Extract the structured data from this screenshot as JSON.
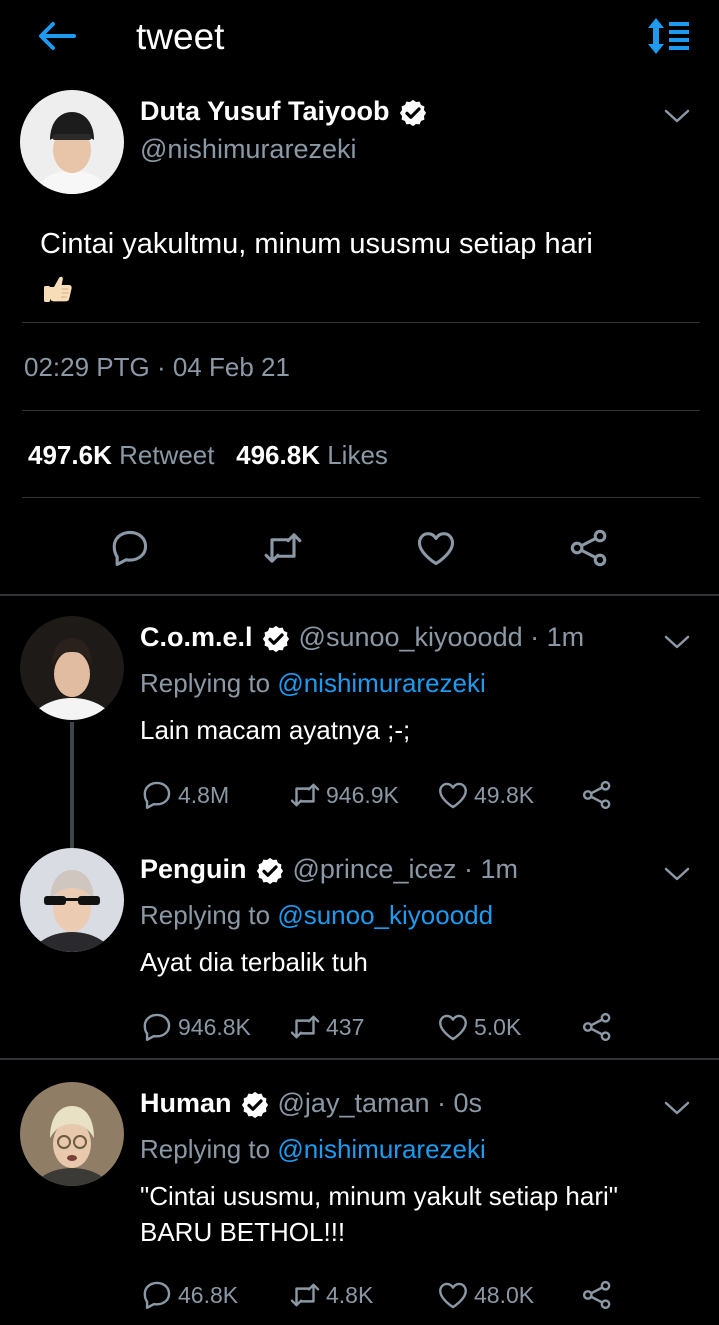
{
  "header": {
    "title": "tweet"
  },
  "tweet": {
    "name": "Duta Yusuf Taiyoob",
    "handle": "@nishimurarezeki",
    "text": "Cintai yakultmu, minum ususmu setiap hari",
    "timestamp": "02:29 PTG · 04 Feb 21",
    "retweet_count": "497.6K",
    "retweet_label": "Retweet",
    "like_count": "496.8K",
    "like_label": "Likes"
  },
  "replies": [
    {
      "name": "C.o.m.e.l",
      "handle": "@sunoo_kiyooodd",
      "time": "· 1m",
      "replying_label": "Replying to",
      "replying_to": "@nishimurarezeki",
      "text": "Lain macam ayatnya ;-;",
      "reply_count": "4.8M",
      "retweet_count": "946.9K",
      "like_count": "49.8K"
    },
    {
      "name": "Penguin",
      "handle": "@prince_icez",
      "time": "· 1m",
      "replying_label": "Replying to",
      "replying_to": "@sunoo_kiyooodd",
      "text": "Ayat dia terbalik tuh",
      "reply_count": "946.8K",
      "retweet_count": "437",
      "like_count": "5.0K"
    },
    {
      "name": "Human",
      "handle": "@jay_taman",
      "time": "· 0s",
      "replying_label": "Replying to",
      "replying_to": "@nishimurarezeki",
      "text_line1": "\"Cintai ususmu, minum yakult setiap hari\"",
      "text_line2": "BARU BETHOL!!!",
      "reply_count": "46.8K",
      "retweet_count": "4.8K",
      "like_count": "48.0K"
    }
  ],
  "colors": {
    "background": "#000000",
    "accent": "#1d9bf0",
    "muted": "#8b98a5",
    "divider": "#2f3336"
  },
  "icons": [
    "back-arrow-icon",
    "sort-icon",
    "verified-icon",
    "chevron-down-icon",
    "reply-icon",
    "retweet-icon",
    "like-icon",
    "share-icon",
    "thumbs-up-emoji"
  ]
}
